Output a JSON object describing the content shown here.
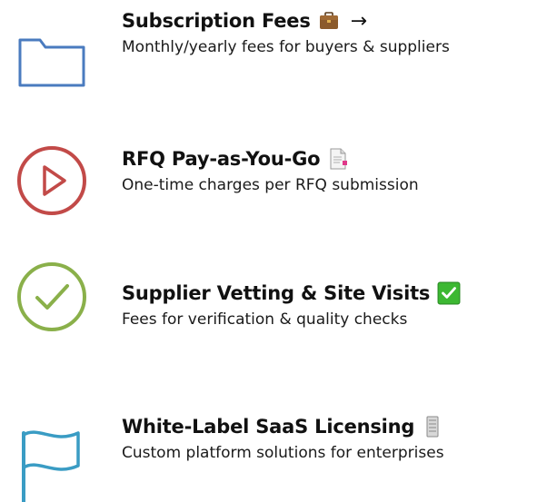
{
  "items": [
    {
      "title": "Subscription Fees",
      "description": "Monthly/yearly fees for buyers & suppliers",
      "icon": "folder-icon",
      "icon_color": "#4a7bbf",
      "title_emoji": "briefcase-icon",
      "arrow": "→"
    },
    {
      "title": "RFQ Pay-as-You-Go",
      "description": "One-time charges per RFQ submission",
      "icon": "play-circle-icon",
      "icon_color": "#c24a48",
      "title_emoji": "document-icon"
    },
    {
      "title": "Supplier Vetting & Site Visits",
      "description": "Fees for verification & quality checks",
      "icon": "check-circle-icon",
      "icon_color": "#8ab04a",
      "title_emoji": "check-box-icon"
    },
    {
      "title": "White-Label SaaS Licensing",
      "description": "Custom platform solutions for enterprises",
      "icon": "flag-icon",
      "icon_color": "#3a9cc4",
      "title_emoji": "server-icon"
    }
  ]
}
